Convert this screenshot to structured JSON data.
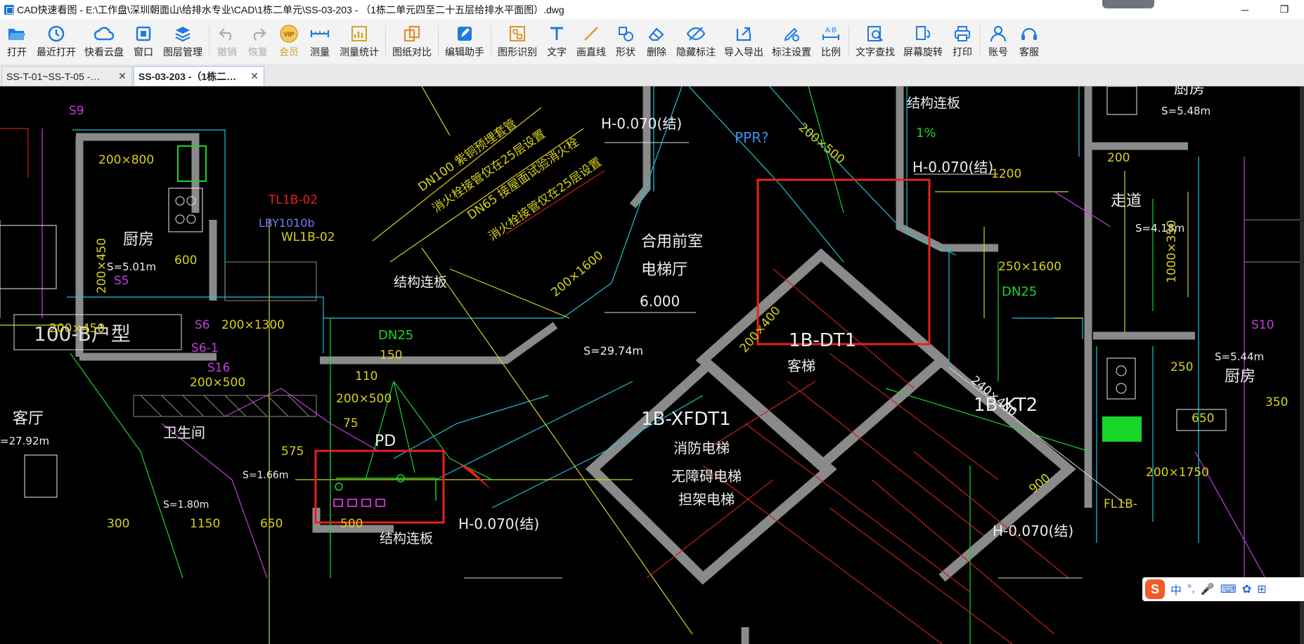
{
  "window": {
    "title": "CAD快速看图 - E:\\工作盘\\深圳朝面山\\给排水专业\\CAD\\1栋二单元\\SS-03-203 - （1栋二单元四至二十五层给排水平面图）.dwg",
    "minimize": "─",
    "maximize": "❐"
  },
  "toolbar": {
    "open": "打开",
    "recent": "最近打开",
    "cloud": "快看云盘",
    "window": "窗口",
    "layers": "图层管理",
    "undo": "撤销",
    "redo": "恢复",
    "vip_badge": "VIP",
    "vip": "会员",
    "measure": "测量",
    "measure_stats": "测量统计",
    "compare": "图纸对比",
    "edit_assistant": "编辑助手",
    "shape_recognize": "图形识别",
    "text": "文字",
    "line": "画直线",
    "shape": "形状",
    "delete": "删除",
    "hide_annot": "隐藏标注",
    "import_export": "导入导出",
    "annot_settings": "标注设置",
    "scale": "比例",
    "text_search": "文字查找",
    "rotate": "屏幕旋转",
    "print": "打印",
    "account": "账号",
    "service": "客服"
  },
  "tabs": [
    {
      "label": "SS-T-01~SS-T-05 -…",
      "close": "✕"
    },
    {
      "label": "SS-03-203 -（1栋二…",
      "close": "✕"
    }
  ],
  "drawing": {
    "labels": {
      "kitchen_left": "厨房",
      "kitchen_left_area": "S=5.01m",
      "dim_200x800": "200×800",
      "dim_200x450": "200×450",
      "dim_600": "600",
      "s5": "S5",
      "s9": "S9",
      "unit_type": "100-B户型",
      "dim_200x450b": "200×450",
      "s6": "S6",
      "s61": "S6-1",
      "dim_200x1300": "200×1300",
      "s16": "S16",
      "dim_200x500": "200×500",
      "living_left": "客厅",
      "living_left_area": "=27.92m",
      "bathroom": "卫生间",
      "bath_area": "S=1.66m",
      "bath_area2": "S=1.80m",
      "dim_1150": "1150",
      "dim_650": "650",
      "dim_500": "500",
      "dim_300": "300",
      "tl1b02": "TL1B-02",
      "lby1010b": "LBY1010b",
      "wl1b02": "WL1B-02",
      "structural_slab": "结构连板",
      "structural_slab2": "结构连板",
      "structural_slab3": "结构连板",
      "pipe_note1": "DN100 紫铜预埋套管",
      "pipe_note2": "消火栓接管仅在25层设置",
      "pipe_note3": "DN65 接屋面试验消火栓",
      "pipe_note4": "消火栓接管仅在25层设置",
      "dn25": "DN25",
      "dim_150": "150",
      "dim_110": "110",
      "dim_200x500b": "200×500",
      "pd": "PD",
      "dim_75": "75",
      "dim_575": "575",
      "lobby": "合用前室",
      "lobby2": "电梯厅",
      "elev_6000": "6.000",
      "lobby_area": "S=29.74m",
      "h0070_a": "H-0.070(结)",
      "h0070_b": "H-0.070(结)",
      "h0070_c": "H-0.070(结)",
      "h0070_d": "H-0.070(结)",
      "ppr": "PPR?",
      "dim_200x1600": "200×1600",
      "dim_200x500c": "200×500",
      "dt1": "1B-DT1",
      "dt1_sub": "客梯",
      "xfdt1": "1B-XFDT1",
      "xfdt1_sub1": "消防电梯",
      "xfdt1_sub2": "无障碍电梯",
      "xfdt1_sub3": "担架电梯",
      "dim_200x400": "200×400",
      "dt2": "1B-KT2",
      "dim_240x400": "240×400",
      "dim_1200": "1200",
      "slope_1pct": "1%",
      "corridor": "走道",
      "corridor_area": "S=4.18m",
      "dim_250x1600": "250×1600",
      "dn25_b": "DN25",
      "dim_1000x350": "1000×350",
      "kitchen_right": "厨房",
      "kitchen_right_area": "S=5.48m",
      "kitchen_right2": "厨房",
      "kitchen_right2_area": "S=5.44m",
      "dim_250": "250",
      "dim_350": "350",
      "dim_650b": "650",
      "dim_200x1750": "200×1750",
      "dim_200": "200",
      "fl1b": "FL1B-",
      "dim_900": "900",
      "s10": "S10"
    }
  },
  "ime": {
    "logo": "S",
    "mode": "中",
    "punct": "°,",
    "mic": "🎤",
    "keyboard": "⌨",
    "skin": "✿",
    "grid": "⊞"
  }
}
